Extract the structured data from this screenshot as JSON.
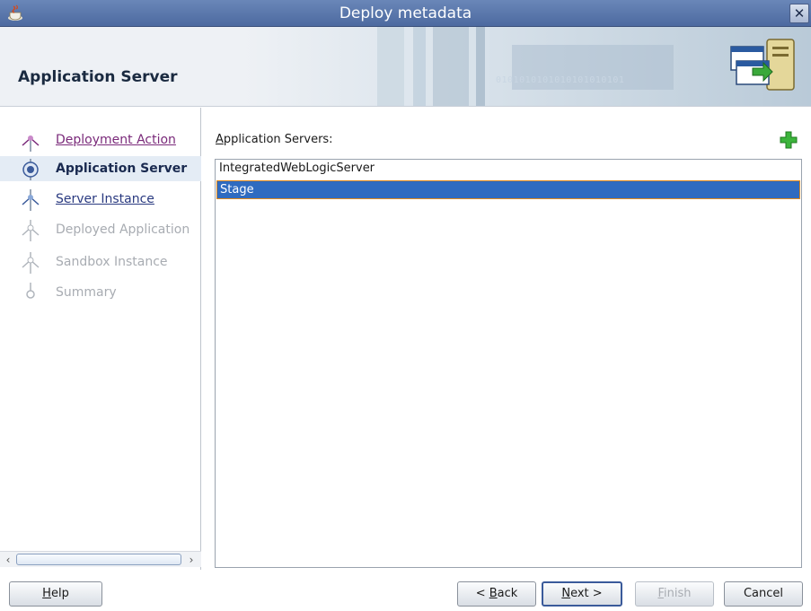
{
  "window": {
    "title": "Deploy metadata",
    "close_label": "✕"
  },
  "header": {
    "page_title": "Application Server",
    "banner_bits": "0101010101010101010101"
  },
  "steps": [
    {
      "label": "Deployment Action",
      "state": "visited"
    },
    {
      "label": "Application Server",
      "state": "current"
    },
    {
      "label": "Server Instance",
      "state": "link"
    },
    {
      "label": "Deployed Application",
      "state": "disabled"
    },
    {
      "label": "Sandbox Instance",
      "state": "disabled"
    },
    {
      "label": "Summary",
      "state": "disabled"
    }
  ],
  "main": {
    "list_label_prefix": "A",
    "list_label_rest": "pplication Servers:",
    "servers": [
      {
        "name": "IntegratedWebLogicServer",
        "selected": false
      },
      {
        "name": "Stage",
        "selected": true
      }
    ]
  },
  "buttons": {
    "help_mnemonic": "H",
    "help_rest": "elp",
    "back_prefix": "< ",
    "back_mnemonic": "B",
    "back_rest": "ack",
    "next_mnemonic": "N",
    "next_rest": "ext >",
    "finish_mnemonic": "F",
    "finish_rest": "inish",
    "cancel": "Cancel"
  },
  "colors": {
    "titlebar": "#5874a8",
    "selection": "#2f6bc0",
    "selection_border": "#e08a1e",
    "add_icon": "#2fa62f"
  }
}
